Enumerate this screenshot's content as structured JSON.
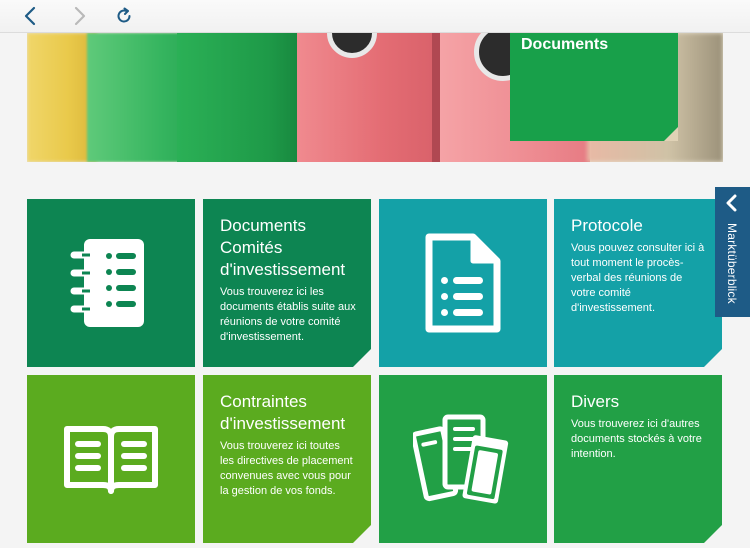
{
  "browser": {
    "back": "back-icon",
    "forward": "forward-icon",
    "reload": "reload-icon"
  },
  "hero": {
    "title": "Documents"
  },
  "tiles": [
    {
      "title": "Documents Comités d'investissement",
      "description": "Vous trouverez ici les documents établis suite aux réunions de votre comité d'investissement.",
      "icon": "notebook-icon",
      "color": "#0d8552"
    },
    {
      "title": "Protocole",
      "description": "Vous pouvez consulter ici à tout moment le procès-verbal des réunions de votre comité d'investissement.",
      "icon": "document-list-icon",
      "color": "#14a1a7"
    },
    {
      "title": "Contraintes d'investissement",
      "description": "Vous trouverez ici toutes les directives de placement convenues avec vous pour la gestion de vos fonds.",
      "icon": "open-book-icon",
      "color": "#5bab1f"
    },
    {
      "title": "Divers",
      "description": "Vous trouverez ici d'autres documents stockés à votre intention.",
      "icon": "documents-stack-icon",
      "color": "#22a046"
    }
  ],
  "sidetab": {
    "label": "Marktüberblick"
  }
}
